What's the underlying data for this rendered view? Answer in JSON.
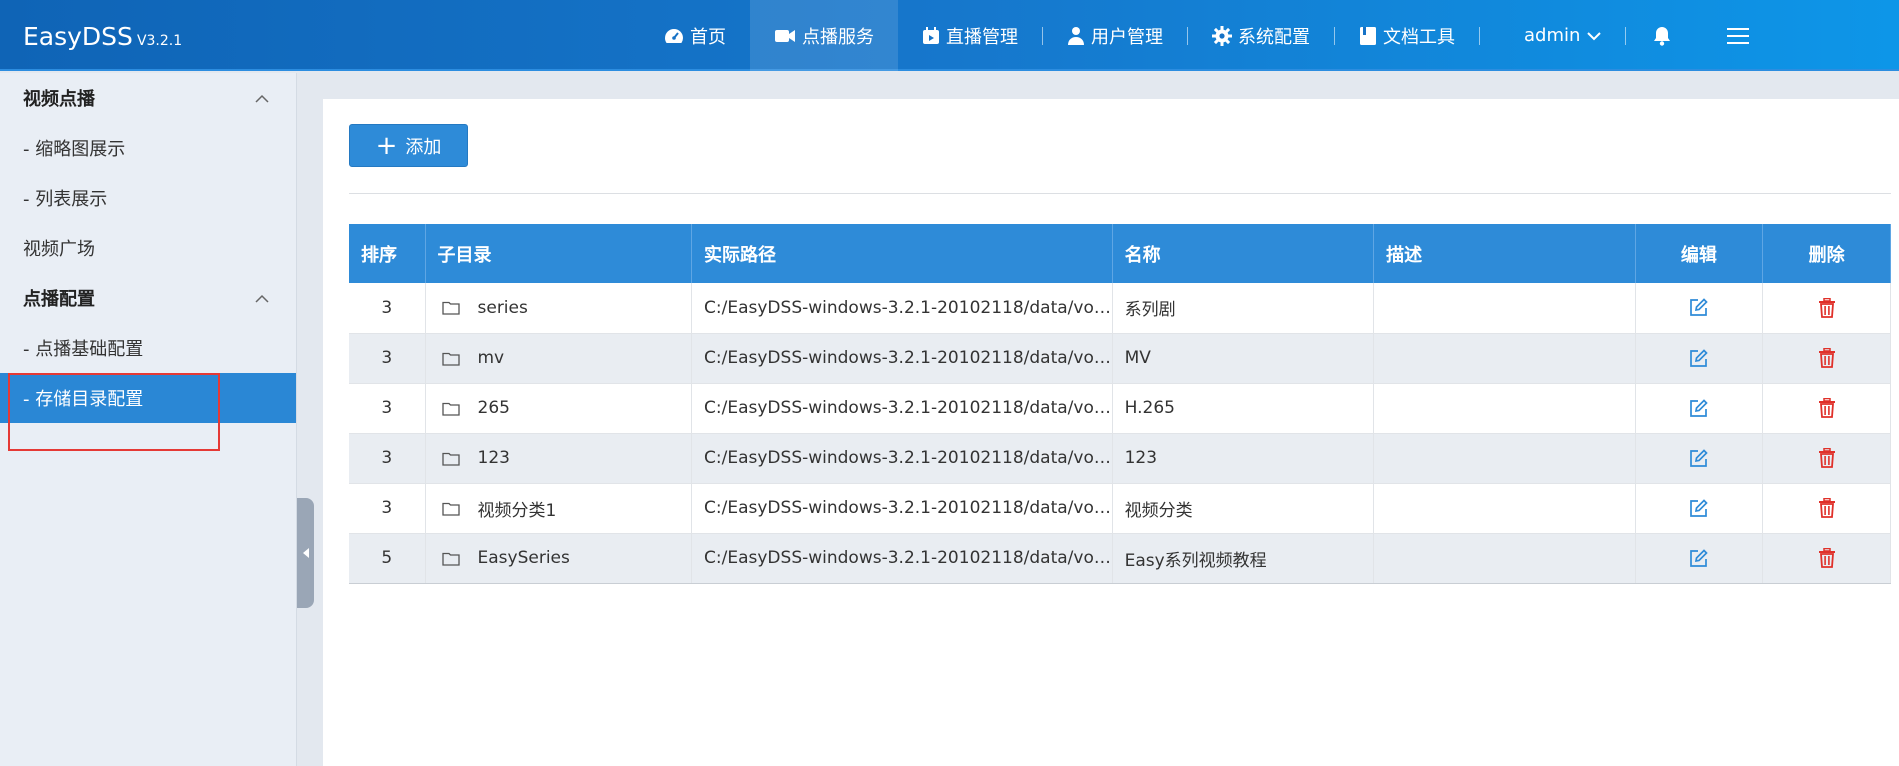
{
  "app": {
    "name": "EasyDSS",
    "version": "V3.2.1",
    "accent": "#2e8bd8",
    "topbar_start": "#0f64b6",
    "topbar_end": "#0d96e8"
  },
  "nav": {
    "items": [
      {
        "label": "首页",
        "icon": "dashboard-icon"
      },
      {
        "label": "点播服务",
        "icon": "video-camera-icon",
        "active": true
      },
      {
        "label": "直播管理",
        "icon": "live-calendar-icon"
      },
      {
        "label": "用户管理",
        "icon": "user-icon"
      },
      {
        "label": "系统配置",
        "icon": "gear-icon"
      },
      {
        "label": "文档工具",
        "icon": "book-icon"
      }
    ],
    "user": "admin"
  },
  "sidebar": {
    "groups": [
      {
        "label": "视频点播",
        "items": [
          "- 缩略图展示",
          "- 列表展示",
          "视频广场"
        ]
      },
      {
        "label": "点播配置",
        "items": [
          "- 点播基础配置",
          "- 存储目录配置"
        ]
      }
    ],
    "active_item": "- 存储目录配置"
  },
  "main": {
    "add_label": "添加",
    "table": {
      "headers": [
        "排序",
        "子目录",
        "实际路径",
        "名称",
        "描述",
        "编辑",
        "删除"
      ],
      "rows": [
        {
          "order": "3",
          "dir": "series",
          "path": "C:/EasyDSS-windows-3.2.1-20102118/data/vod…",
          "name": "系列剧",
          "desc": ""
        },
        {
          "order": "3",
          "dir": "mv",
          "path": "C:/EasyDSS-windows-3.2.1-20102118/data/vod…",
          "name": "MV",
          "desc": ""
        },
        {
          "order": "3",
          "dir": "265",
          "path": "C:/EasyDSS-windows-3.2.1-20102118/data/vod…",
          "name": "H.265",
          "desc": ""
        },
        {
          "order": "3",
          "dir": "123",
          "path": "C:/EasyDSS-windows-3.2.1-20102118/data/vod…",
          "name": "123",
          "desc": ""
        },
        {
          "order": "3",
          "dir": "视频分类1",
          "path": "C:/EasyDSS-windows-3.2.1-20102118/data/vod…",
          "name": "视频分类",
          "desc": ""
        },
        {
          "order": "5",
          "dir": "EasySeries",
          "path": "C:/EasyDSS-windows-3.2.1-20102118/data/vod…",
          "name": "Easy系列视频教程",
          "desc": ""
        }
      ]
    }
  }
}
